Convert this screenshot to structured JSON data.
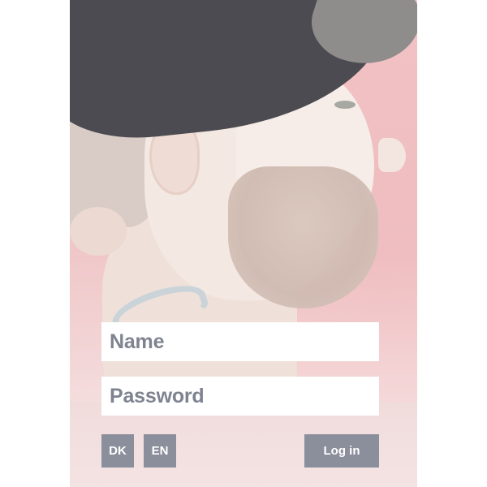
{
  "login": {
    "name_placeholder": "Name",
    "password_placeholder": "Password",
    "login_label": "Log in"
  },
  "language": {
    "options": [
      "DK",
      "EN"
    ]
  },
  "colors": {
    "button_bg": "#8b8f9c",
    "field_bg": "#ffffff",
    "placeholder_text": "#7e8390",
    "background_tint": "#f1d7d8"
  }
}
